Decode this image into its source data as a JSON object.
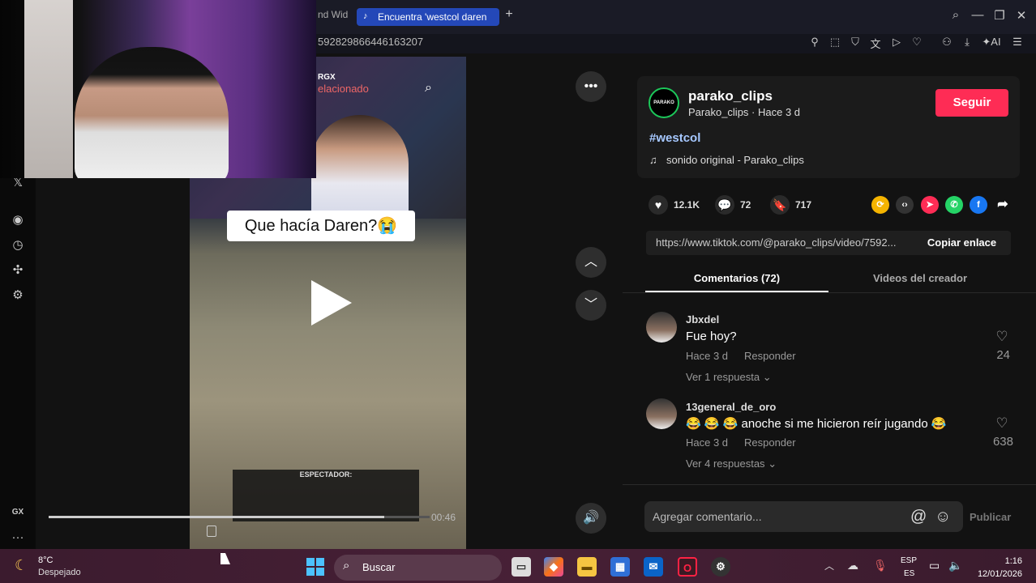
{
  "browser": {
    "tab_prev_fragment": "nd Wid",
    "tab_active_label": "Encuentra 'westcol daren",
    "tab_new": "+",
    "url_fragment": "592829866446163207",
    "ai_label": "AI"
  },
  "video": {
    "watermark": "RGX",
    "related_fragment": "elacionado",
    "caption": "Que hacía Daren?😭",
    "spectator_label": "ESPECTADOR:",
    "time": "00:46",
    "progress": 0.88
  },
  "author": {
    "logo_text": "PARAKO",
    "username": "parako_clips",
    "subline": "Parako_clips · Hace 3 d",
    "follow_label": "Seguir",
    "hashtag": "#westcol",
    "sound": "sonido original - Parako_clips"
  },
  "actions": {
    "likes": "12.1K",
    "comments": "72",
    "saves": "717"
  },
  "link": {
    "url": "https://www.tiktok.com/@parako_clips/video/7592...",
    "copy_label": "Copiar enlace"
  },
  "tabs": {
    "comments": "Comentarios (72)",
    "creator": "Videos del creador"
  },
  "comments": [
    {
      "user": "Jbxdel",
      "text": "Fue hoy?",
      "time": "Hace 3 d",
      "reply": "Responder",
      "more": "Ver 1 respuesta",
      "likes": "24"
    },
    {
      "user": "13general_de_oro",
      "text": "😂 😂 😂 anoche si me hicieron reír jugando 😂",
      "time": "Hace 3 d",
      "reply": "Responder",
      "more": "Ver 4 respuestas",
      "likes": "638"
    }
  ],
  "composer": {
    "placeholder": "Agregar comentario...",
    "publish": "Publicar"
  },
  "sidebar": {
    "gx": "GX",
    "more": "···"
  },
  "taskbar": {
    "temp": "8°C",
    "weather": "Despejado",
    "search": "Buscar",
    "lang_top": "ESP",
    "lang_bottom": "ES",
    "time": "1:16",
    "date": "12/01/2026"
  },
  "colors": {
    "follow": "#fe2c55",
    "hashtag": "#a6c8ff",
    "tab_active": "#2448b8"
  }
}
